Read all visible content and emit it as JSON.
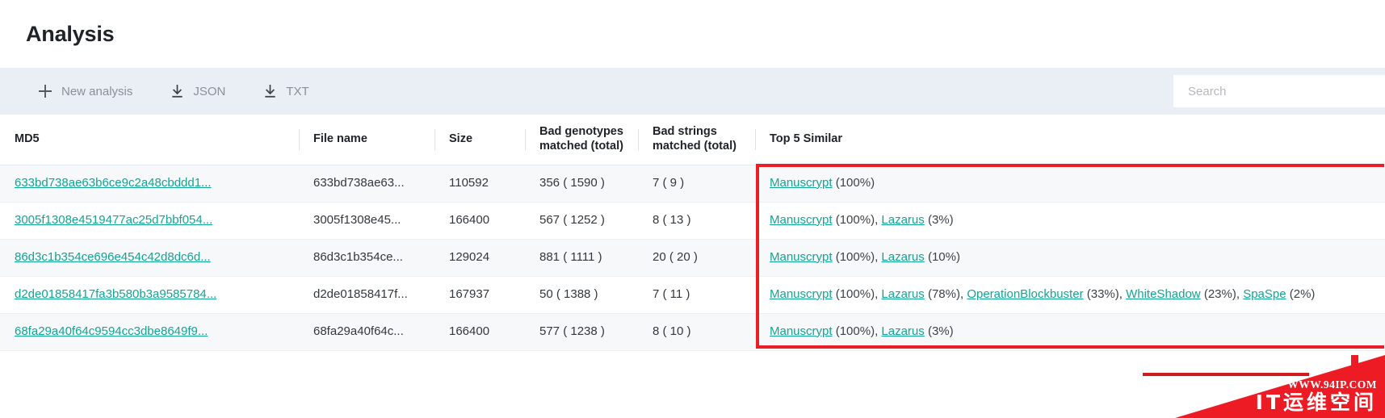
{
  "page": {
    "title": "Analysis"
  },
  "toolbar": {
    "new_analysis_label": "New analysis",
    "json_label": "JSON",
    "txt_label": "TXT",
    "icons": {
      "new_analysis": "plus-icon",
      "json": "download-icon",
      "txt": "download-icon",
      "search": "search-icon"
    }
  },
  "search": {
    "value": "",
    "placeholder": "Search"
  },
  "table": {
    "columns": [
      "MD5",
      "File name",
      "Size",
      "Bad genotypes matched (total)",
      "Bad strings matched (total)",
      "Top 5 Similar"
    ],
    "column_lines": {
      "md5": "MD5",
      "file_name": "File name",
      "size": "Size",
      "bad_genotypes_l1": "Bad genotypes",
      "bad_genotypes_l2": "matched (total)",
      "bad_strings_l1": "Bad strings",
      "bad_strings_l2": "matched (total)",
      "top5": "Top 5 Similar"
    },
    "rows": [
      {
        "md5": "633bd738ae63b6ce9c2a48cbddd1...",
        "file_name": "633bd738ae63...",
        "size": "110592",
        "bad_genotypes": "356 ( 1590 )",
        "bad_strings": "7 ( 9 )",
        "similar": [
          {
            "name": "Manuscrypt",
            "pct": "(100%)"
          }
        ]
      },
      {
        "md5": "3005f1308e4519477ac25d7bbf054...",
        "file_name": "3005f1308e45...",
        "size": "166400",
        "bad_genotypes": "567 ( 1252 )",
        "bad_strings": "8 ( 13 )",
        "similar": [
          {
            "name": "Manuscrypt",
            "pct": "(100%)"
          },
          {
            "name": "Lazarus",
            "pct": "(3%)"
          }
        ]
      },
      {
        "md5": "86d3c1b354ce696e454c42d8dc6d...",
        "file_name": "86d3c1b354ce...",
        "size": "129024",
        "bad_genotypes": "881 ( 1111 )",
        "bad_strings": "20 ( 20 )",
        "similar": [
          {
            "name": "Manuscrypt",
            "pct": "(100%)"
          },
          {
            "name": "Lazarus",
            "pct": "(10%)"
          }
        ]
      },
      {
        "md5": "d2de01858417fa3b580b3a9585784...",
        "file_name": "d2de01858417f...",
        "size": "167937",
        "bad_genotypes": "50 ( 1388 )",
        "bad_strings": "7 ( 11 )",
        "similar": [
          {
            "name": "Manuscrypt",
            "pct": "(100%)"
          },
          {
            "name": "Lazarus",
            "pct": "(78%)"
          },
          {
            "name": "OperationBlockbuster",
            "pct": "(33%)"
          },
          {
            "name": "WhiteShadow",
            "pct": "(23%)"
          },
          {
            "name": "SpaSpe",
            "pct": "(2%)"
          }
        ]
      },
      {
        "md5": "68fa29a40f64c9594cc3dbe8649f9...",
        "file_name": "68fa29a40f64c...",
        "size": "166400",
        "bad_genotypes": "577 ( 1238 )",
        "bad_strings": "8 ( 10 )",
        "similar": [
          {
            "name": "Manuscrypt",
            "pct": "(100%)"
          },
          {
            "name": "Lazarus",
            "pct": "(3%)"
          }
        ]
      }
    ]
  },
  "annotation": {
    "highlight_color": "#e81f26"
  },
  "watermark": {
    "url": "WWW.94IP.COM",
    "text": "IT运维空间",
    "color": "#ed1c24"
  },
  "colors": {
    "link": "#12a594",
    "toolbar_bg": "#eaeff5",
    "row_alt_bg": "#f7f8f9"
  }
}
